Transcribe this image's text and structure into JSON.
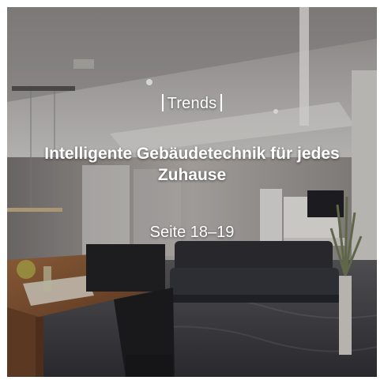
{
  "teaser": {
    "category": "Trends",
    "headline": "Intelligente Gebäudetechnik für jedes Zuhause",
    "pages": "Seite 18–19"
  },
  "colors": {
    "text": "#ffffff",
    "ceiling": "#e4e4e2",
    "wood": "#8a5a36",
    "sofa": "#2a2c30",
    "floor": "#3c3c40"
  },
  "icons": {
    "pendant_lamp": "pendant-lamp-icon",
    "tv": "tv-icon",
    "plant": "plant-icon"
  }
}
